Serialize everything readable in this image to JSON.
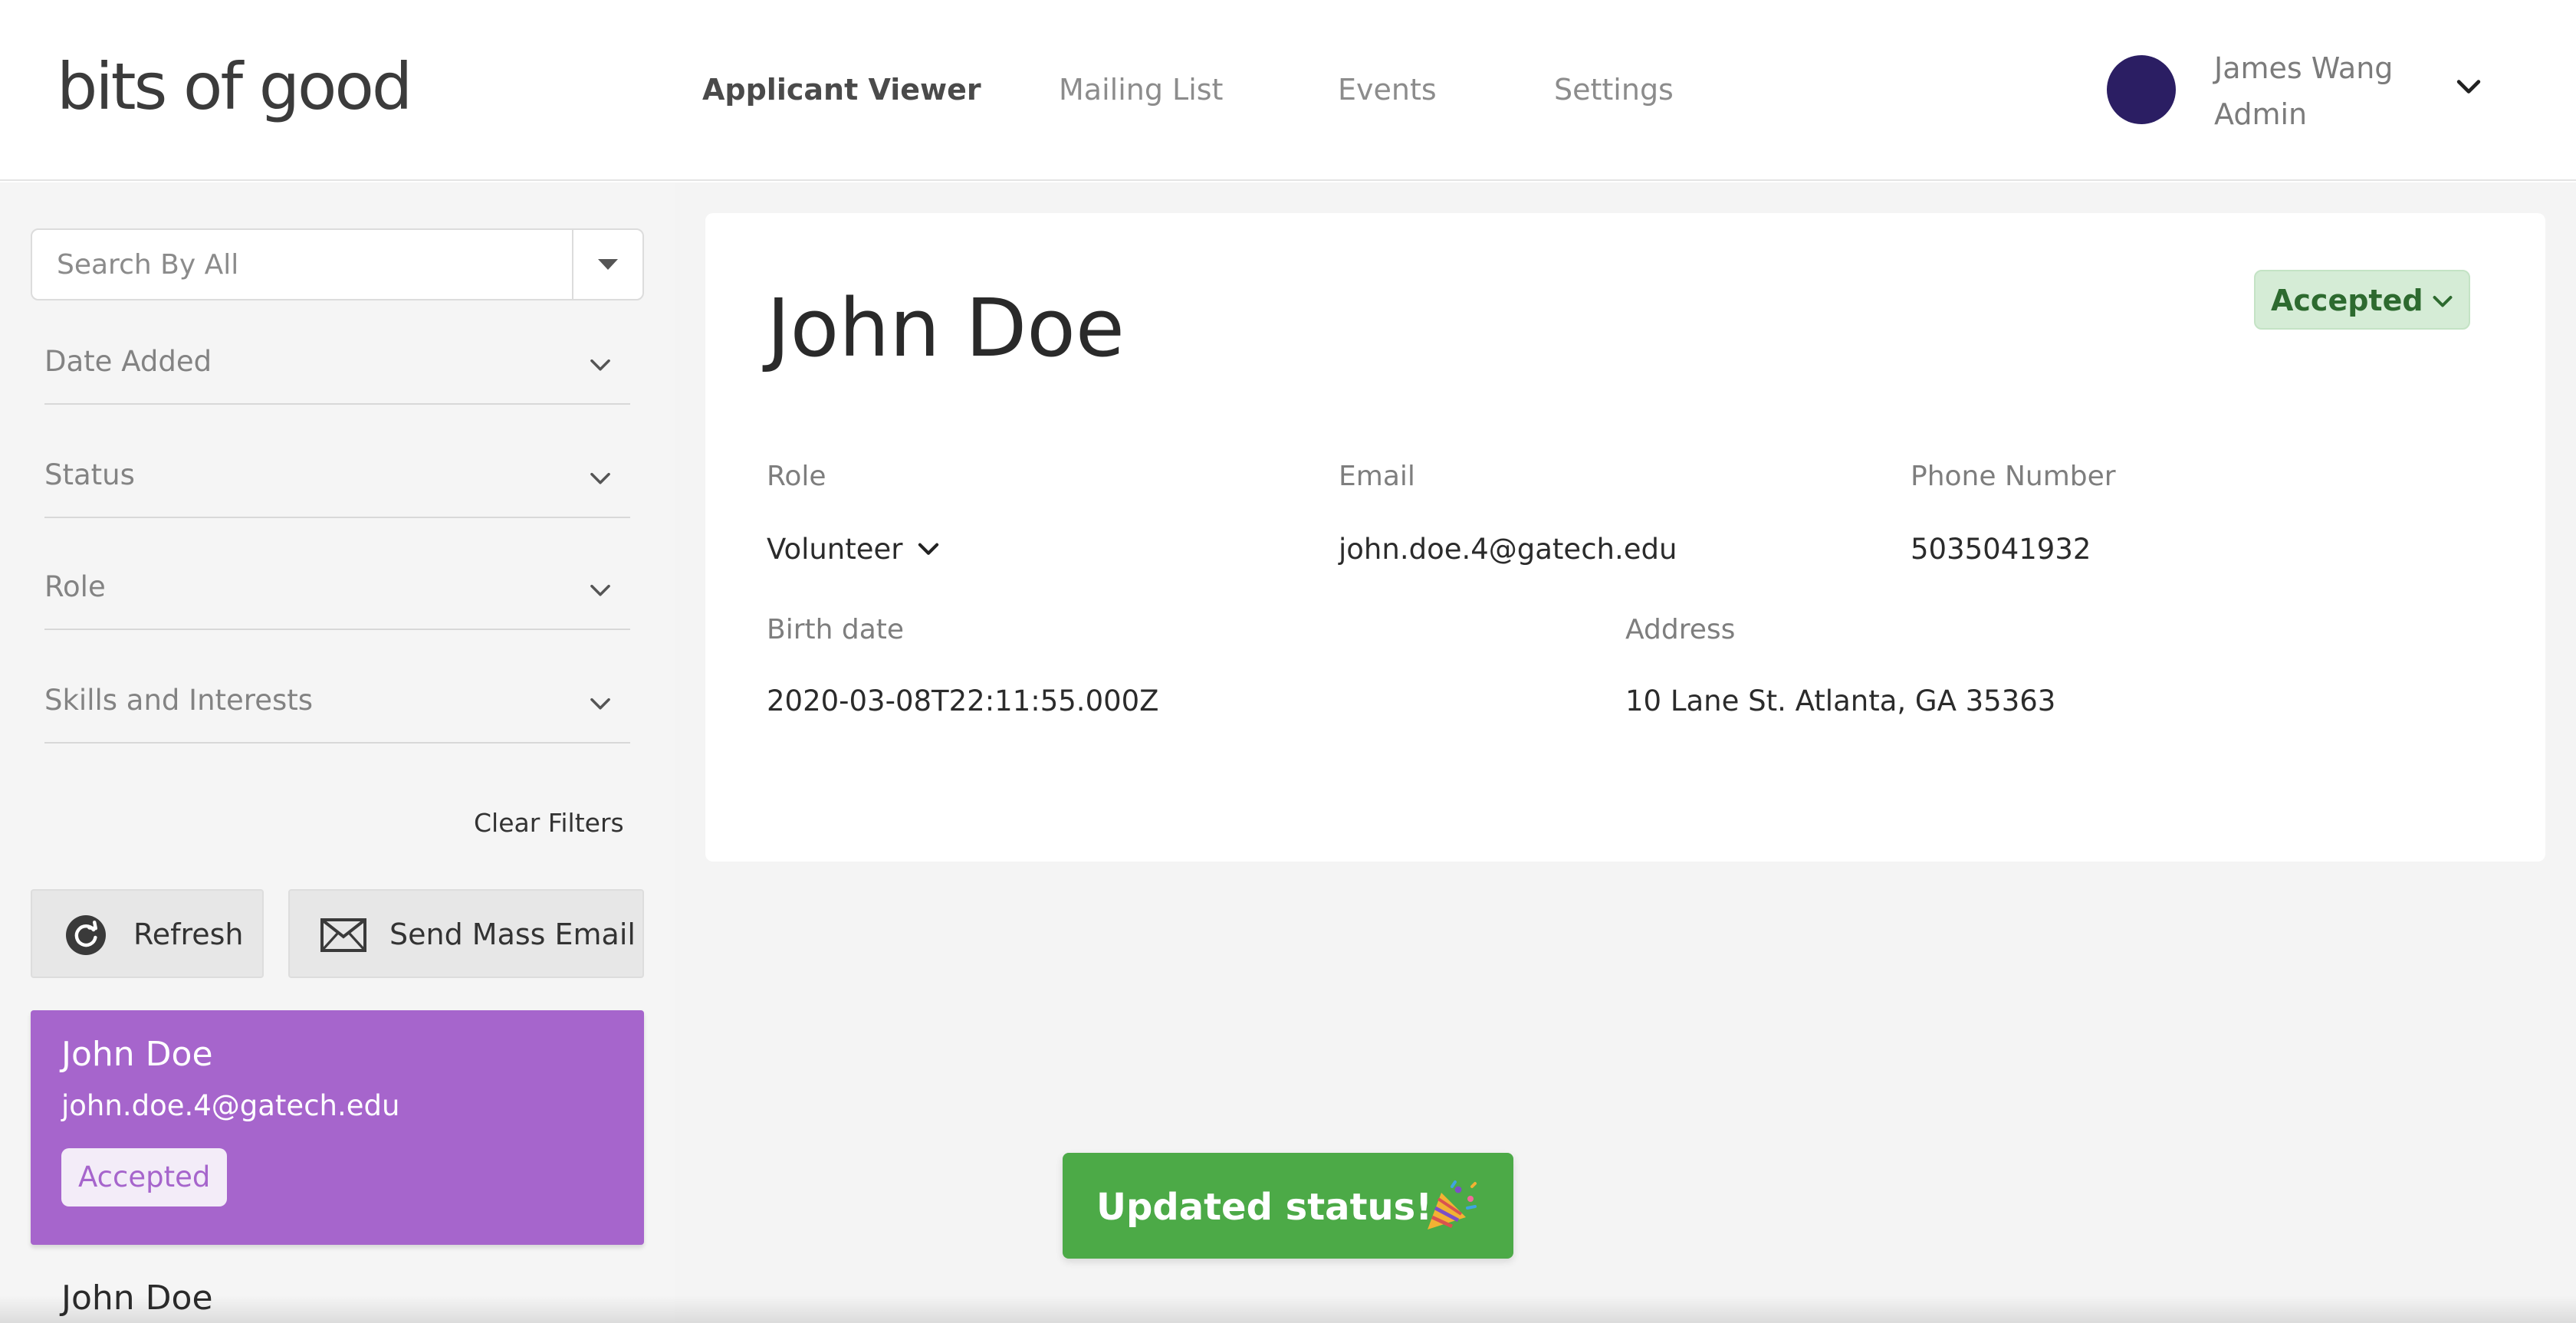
{
  "header": {
    "logo_text": "bits of good",
    "nav": [
      {
        "label": "Applicant Viewer",
        "active": true
      },
      {
        "label": "Mailing List",
        "active": false
      },
      {
        "label": "Events",
        "active": false
      },
      {
        "label": "Settings",
        "active": false
      }
    ],
    "user": {
      "name": "James Wang",
      "role": "Admin",
      "avatar_color": "#2b1e63"
    }
  },
  "sidebar": {
    "search_placeholder": "Search By All",
    "filters": [
      {
        "label": "Date Added"
      },
      {
        "label": "Status"
      },
      {
        "label": "Role"
      },
      {
        "label": "Skills and Interests"
      }
    ],
    "clear_filters_label": "Clear Filters",
    "refresh_label": "Refresh",
    "mass_email_label": "Send Mass Email",
    "applicants": [
      {
        "name": "John Doe",
        "email": "john.doe.4@gatech.edu",
        "status": "Accepted",
        "selected": true
      },
      {
        "name": "John Doe"
      }
    ]
  },
  "detail": {
    "name": "John Doe",
    "status": "Accepted",
    "labels": {
      "role": "Role",
      "email": "Email",
      "phone": "Phone Number",
      "birth_date": "Birth date",
      "address": "Address"
    },
    "values": {
      "role": "Volunteer",
      "email": "john.doe.4@gatech.edu",
      "phone": "5035041932",
      "birth_date": "2020-03-08T22:11:55.000Z",
      "address": "10 Lane St. Atlanta, GA 35363"
    }
  },
  "toast": {
    "message": "Updated status!",
    "icon": "party-popper-icon"
  },
  "colors": {
    "accent_purple": "#a665cc",
    "status_green_bg": "#d5ecd6",
    "status_green_text": "#2d6a2f",
    "toast_green": "#4caa47"
  }
}
